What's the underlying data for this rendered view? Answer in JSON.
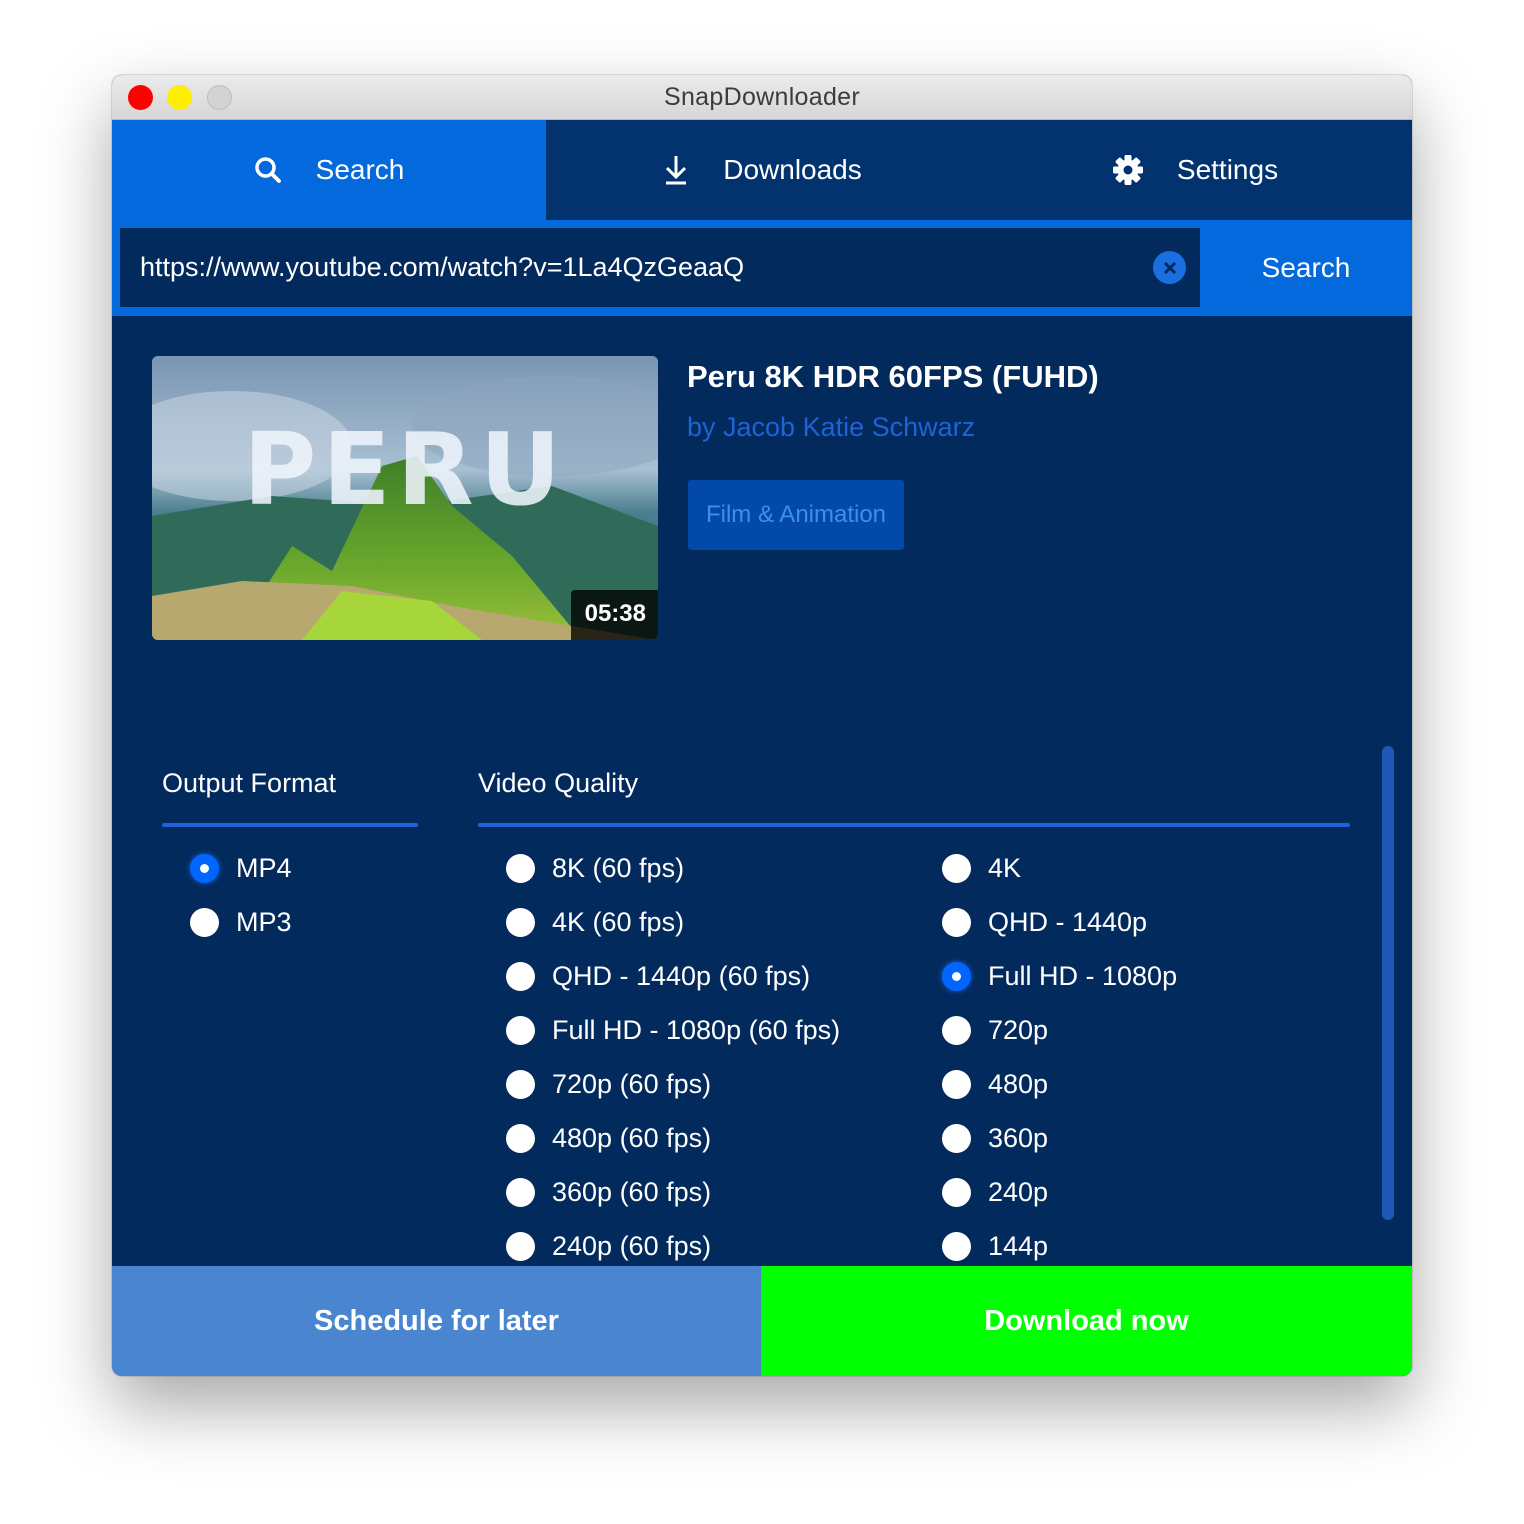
{
  "window": {
    "title": "SnapDownloader",
    "controls": [
      "close",
      "minimize",
      "maximize"
    ]
  },
  "tabs": [
    {
      "label": "Search",
      "icon": "search-icon",
      "active": true
    },
    {
      "label": "Downloads",
      "icon": "download-icon",
      "active": false
    },
    {
      "label": "Settings",
      "icon": "gear-icon",
      "active": false
    }
  ],
  "search": {
    "url_value": "https://www.youtube.com/watch?v=1La4QzGeaaQ",
    "clear_icon": "close-circle-icon",
    "button_label": "Search"
  },
  "video": {
    "thumbnail_text": "PERU",
    "duration": "05:38",
    "title": "Peru 8K HDR 60FPS (FUHD)",
    "channel": "by Jacob Katie Schwarz",
    "category": "Film & Animation"
  },
  "output_format": {
    "heading": "Output Format",
    "options": [
      {
        "label": "MP4",
        "selected": true
      },
      {
        "label": "MP3",
        "selected": false
      }
    ]
  },
  "video_quality": {
    "heading": "Video Quality",
    "column1": [
      {
        "label": "8K (60 fps)",
        "selected": false
      },
      {
        "label": "4K (60 fps)",
        "selected": false
      },
      {
        "label": "QHD - 1440p (60 fps)",
        "selected": false
      },
      {
        "label": "Full HD - 1080p (60 fps)",
        "selected": false
      },
      {
        "label": "720p (60 fps)",
        "selected": false
      },
      {
        "label": "480p (60 fps)",
        "selected": false
      },
      {
        "label": "360p (60 fps)",
        "selected": false
      },
      {
        "label": "240p (60 fps)",
        "selected": false
      }
    ],
    "column2": [
      {
        "label": "4K",
        "selected": false
      },
      {
        "label": "QHD - 1440p",
        "selected": false
      },
      {
        "label": "Full HD - 1080p",
        "selected": true
      },
      {
        "label": "720p",
        "selected": false
      },
      {
        "label": "480p",
        "selected": false
      },
      {
        "label": "360p",
        "selected": false
      },
      {
        "label": "240p",
        "selected": false
      },
      {
        "label": "144p",
        "selected": false
      }
    ]
  },
  "actions": {
    "schedule_label": "Schedule for later",
    "download_label": "Download now"
  },
  "colors": {
    "tab_active": "#0369dc",
    "background": "#022a5c",
    "accent": "#1f63d6",
    "schedule": "#4a86d0",
    "download": "#00ff00"
  }
}
